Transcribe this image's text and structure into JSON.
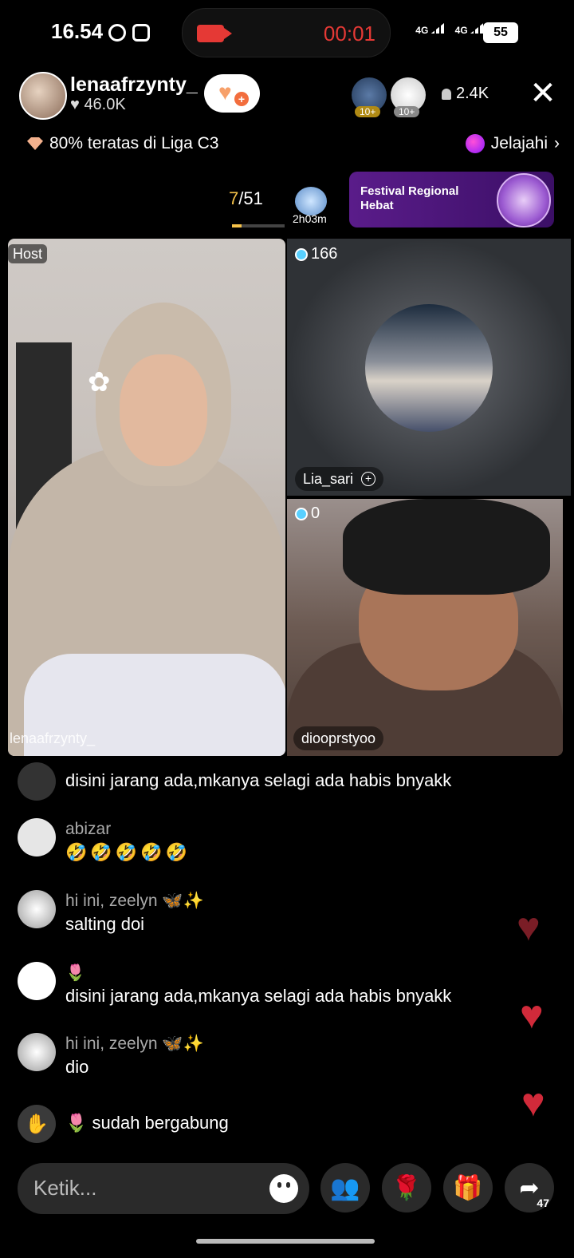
{
  "status_bar": {
    "time": "16.54",
    "recording_time": "00:01",
    "network": [
      "4G",
      "4G"
    ],
    "battery": "55"
  },
  "host": {
    "username": "lenaafrzynty_",
    "likes": "46.0K"
  },
  "viewers": {
    "count": "2.4K",
    "badge1": "10+",
    "badge2": "10+"
  },
  "league": {
    "text": "80% teratas di Liga C3",
    "explore_label": "Jelajahi"
  },
  "rank": {
    "current": "7",
    "total": "/51",
    "timer": "2h03m",
    "progress": 0.18
  },
  "banner": {
    "title": "Festival Regional Hebat"
  },
  "tiles": {
    "host_tag": "Host",
    "host_name": "lenaafrzynty_",
    "guest1": {
      "gems": "166",
      "name": "Lia_sari"
    },
    "guest2": {
      "gems": "0",
      "name": "diooprstyoo"
    }
  },
  "comments": [
    {
      "user": "",
      "text": "disini jarang ada,mkanya selagi ada habis bnyakk"
    },
    {
      "user": "abizar",
      "text": "🤣🤣🤣🤣🤣"
    },
    {
      "user": "hi ini, zeelyn 🦋✨",
      "text": "salting doi"
    },
    {
      "user": "🌷",
      "text": "disini jarang ada,mkanya selagi ada habis bnyakk"
    },
    {
      "user": "hi ini, zeelyn 🦋✨",
      "text": "dio"
    },
    {
      "user": "",
      "text": "🌷 sudah bergabung"
    }
  ],
  "bottom_bar": {
    "input_placeholder": "Ketik...",
    "share_count": "47"
  },
  "colors": {
    "accent_red": "#e53935",
    "rank_gold": "#f5c24a",
    "banner_purple": "#5a1c8a"
  }
}
